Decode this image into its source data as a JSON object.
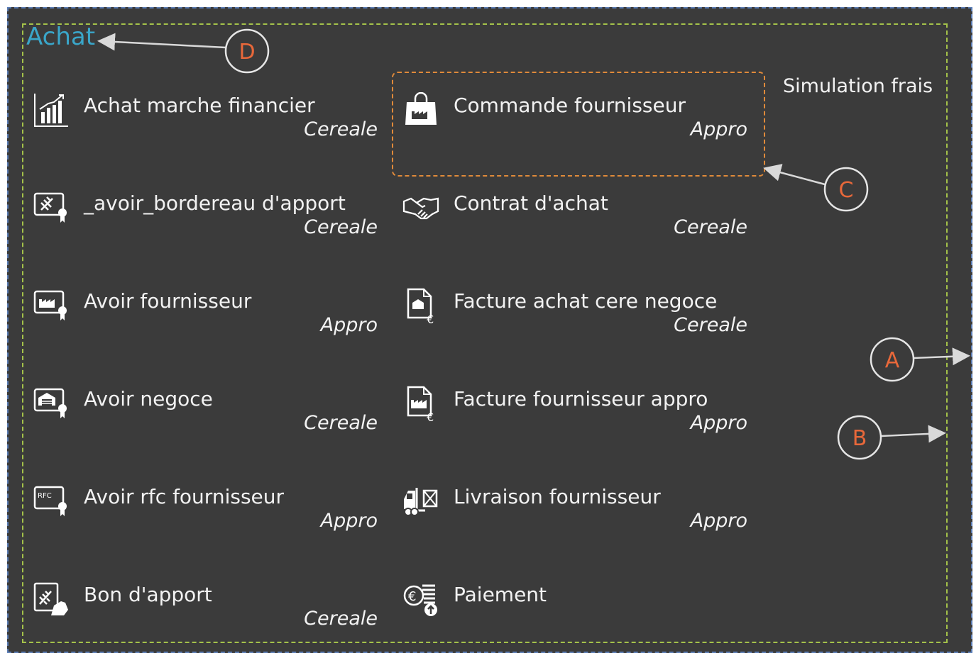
{
  "group": {
    "title": "Achat",
    "side_link": "Simulation frais"
  },
  "items": [
    {
      "label": "Achat marche financier",
      "category": "Cereale",
      "icon": "chart-bars-icon"
    },
    {
      "label": "_avoir_bordereau d'apport",
      "category": "Cereale",
      "icon": "wheat-certificate-icon"
    },
    {
      "label": "Avoir fournisseur",
      "category": "Appro",
      "icon": "factory-certificate-icon"
    },
    {
      "label": "Avoir negoce",
      "category": "Cereale",
      "icon": "warehouse-certificate-icon"
    },
    {
      "label": "Avoir rfc fournisseur",
      "category": "Appro",
      "icon": "rfc-certificate-icon"
    },
    {
      "label": "Bon d'apport",
      "category": "Cereale",
      "icon": "wheat-hand-icon"
    },
    {
      "label": "Commande fournisseur",
      "category": "Appro",
      "icon": "shopping-bag-factory-icon"
    },
    {
      "label": "Contrat d'achat",
      "category": "Cereale",
      "icon": "handshake-icon"
    },
    {
      "label": "Facture achat cere negoce",
      "category": "Cereale",
      "icon": "invoice-euro-icon"
    },
    {
      "label": "Facture fournisseur appro",
      "category": "Appro",
      "icon": "invoice-factory-euro-icon"
    },
    {
      "label": "Livraison fournisseur",
      "category": "Appro",
      "icon": "forklift-icon"
    },
    {
      "label": "Paiement",
      "category": "",
      "icon": "euro-coins-icon"
    }
  ],
  "callouts": [
    "A",
    "B",
    "C",
    "D"
  ],
  "colors": {
    "background": "#3b3b3b",
    "title": "#3aa6c9",
    "group_border": "#a4c24a",
    "outer_border": "#5b7db5",
    "highlight": "#e08a3a",
    "callout": "#e8683a"
  }
}
